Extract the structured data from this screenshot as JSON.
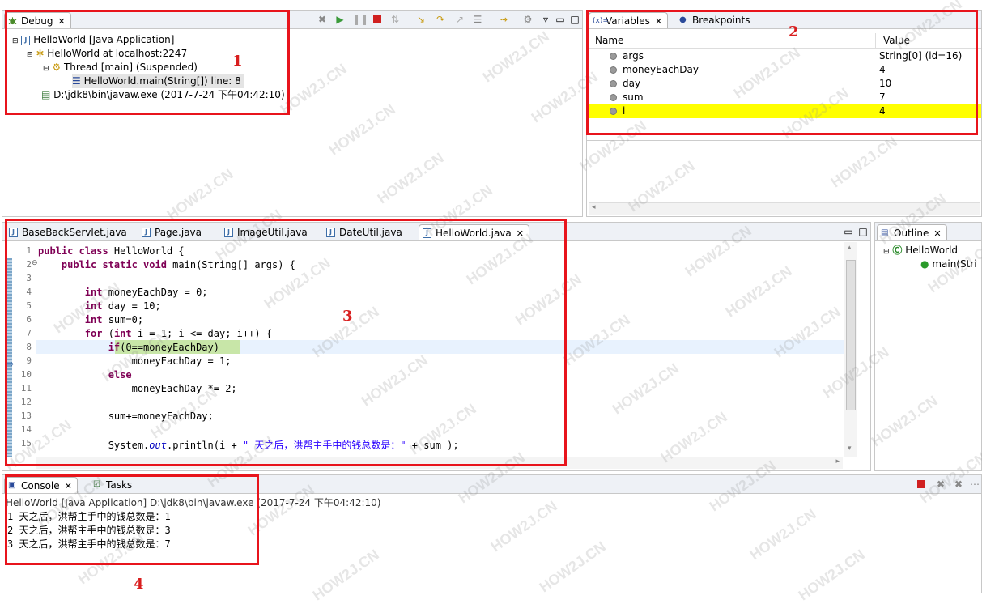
{
  "debug": {
    "tab_label": "Debug",
    "tree": [
      {
        "label": "HelloWorld [Java Application]",
        "icon": "java-app-icon"
      },
      {
        "label": "HelloWorld at localhost:2247",
        "icon": "debug-target-icon"
      },
      {
        "label": "Thread [main] (Suspended)",
        "icon": "thread-suspended-icon"
      },
      {
        "label": "HelloWorld.main(String[]) line: 8",
        "icon": "stack-frame-icon"
      },
      {
        "label": "D:\\jdk8\\bin\\javaw.exe (2017-7-24 下午04:42:10)",
        "icon": "process-icon"
      }
    ],
    "marker": "1"
  },
  "variables": {
    "tabs": [
      {
        "label": "Variables"
      },
      {
        "label": "Breakpoints"
      }
    ],
    "col_name": "Name",
    "col_value": "Value",
    "rows": [
      {
        "name": "args",
        "value": "String[0]  (id=16)"
      },
      {
        "name": "moneyEachDay",
        "value": "4"
      },
      {
        "name": "day",
        "value": "10"
      },
      {
        "name": "sum",
        "value": "7"
      },
      {
        "name": "i",
        "value": "4"
      }
    ],
    "highlight_color": "#ffff00",
    "marker": "2"
  },
  "editor": {
    "tabs": [
      {
        "label": "BaseBackServlet.java"
      },
      {
        "label": "Page.java"
      },
      {
        "label": "ImageUtil.java"
      },
      {
        "label": "DateUtil.java"
      },
      {
        "label": "HelloWorld.java"
      }
    ],
    "line_numbers": [
      "1",
      "2",
      "3",
      "4",
      "5",
      "6",
      "7",
      "8",
      "9",
      "10",
      "11",
      "12",
      "13",
      "14",
      "15"
    ],
    "current_line_color": "#c8e6a8",
    "marker": "3"
  },
  "outline": {
    "tab_label": "Outline",
    "class_name": "HelloWorld",
    "method_name": "main(Stri"
  },
  "console": {
    "tabs": [
      {
        "label": "Console"
      },
      {
        "label": "Tasks"
      }
    ],
    "header": "HelloWorld [Java Application] D:\\jdk8\\bin\\javaw.exe (2017-7-24 下午04:42:10)",
    "lines": [
      "1 天之后，洪帮主手中的钱总数是：1",
      "2 天之后，洪帮主手中的钱总数是：3",
      "3 天之后，洪帮主手中的钱总数是：7"
    ],
    "marker": "4"
  },
  "watermark": "HOW2J.CN"
}
